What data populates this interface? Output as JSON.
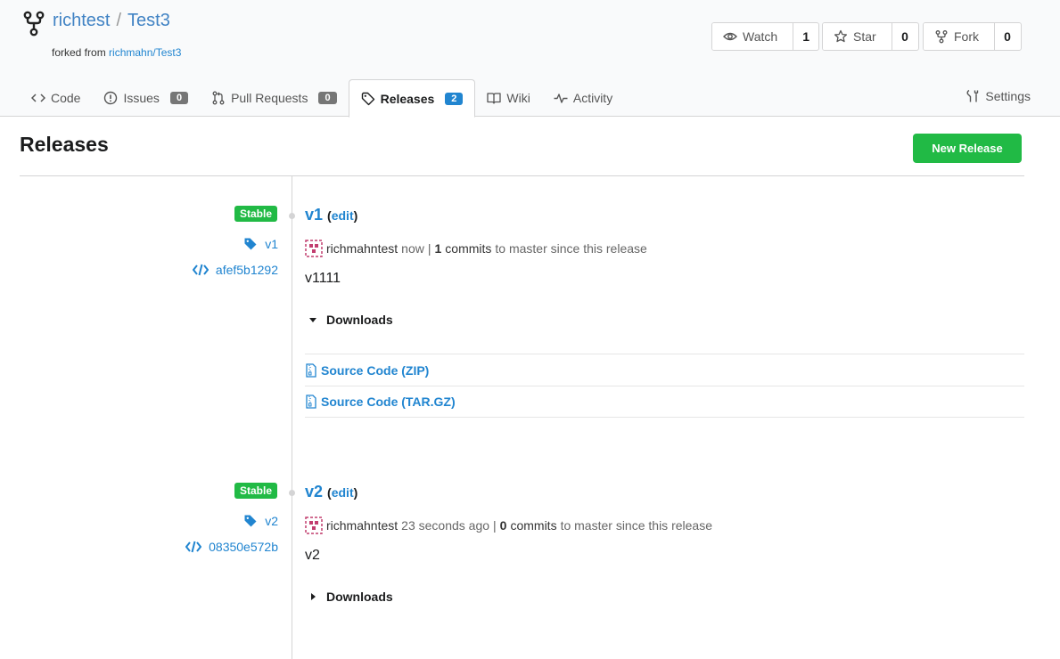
{
  "repo": {
    "owner": "richtest",
    "separator": "/",
    "name": "Test3",
    "forked_prefix": "forked from",
    "forked_from": "richmahn/Test3"
  },
  "actions": {
    "watch_label": "Watch",
    "watch_count": "1",
    "star_label": "Star",
    "star_count": "0",
    "fork_label": "Fork",
    "fork_count": "0"
  },
  "tabs": [
    {
      "label": "Code",
      "icon": "code-icon"
    },
    {
      "label": "Issues",
      "icon": "issue-icon",
      "count": "0"
    },
    {
      "label": "Pull Requests",
      "icon": "pull-request-icon",
      "count": "0"
    },
    {
      "label": "Releases",
      "icon": "tag-icon",
      "count": "2",
      "active": true
    },
    {
      "label": "Wiki",
      "icon": "book-icon"
    },
    {
      "label": "Activity",
      "icon": "pulse-icon"
    }
  ],
  "settings_label": "Settings",
  "page": {
    "title": "Releases",
    "new_release_label": "New Release"
  },
  "colors": {
    "accent": "#2185d0",
    "success": "#21ba45"
  },
  "releases": [
    {
      "badge": "Stable",
      "tag": "v1",
      "commit": "afef5b1292",
      "title": "v1",
      "edit_label": "edit",
      "author": "richmahntest",
      "time": "now",
      "commits_count": "1",
      "commits_text": "commits",
      "commits_suffix": "to master since this release",
      "body": "v1111",
      "downloads_label": "Downloads",
      "downloads_expanded": true,
      "downloads": [
        "Source Code (ZIP)",
        "Source Code (TAR.GZ)"
      ]
    },
    {
      "badge": "Stable",
      "tag": "v2",
      "commit": "08350e572b",
      "title": "v2",
      "edit_label": "edit",
      "author": "richmahntest",
      "time": "23 seconds ago",
      "commits_count": "0",
      "commits_text": "commits",
      "commits_suffix": "to master since this release",
      "body": "v2",
      "downloads_label": "Downloads",
      "downloads_expanded": false
    }
  ]
}
